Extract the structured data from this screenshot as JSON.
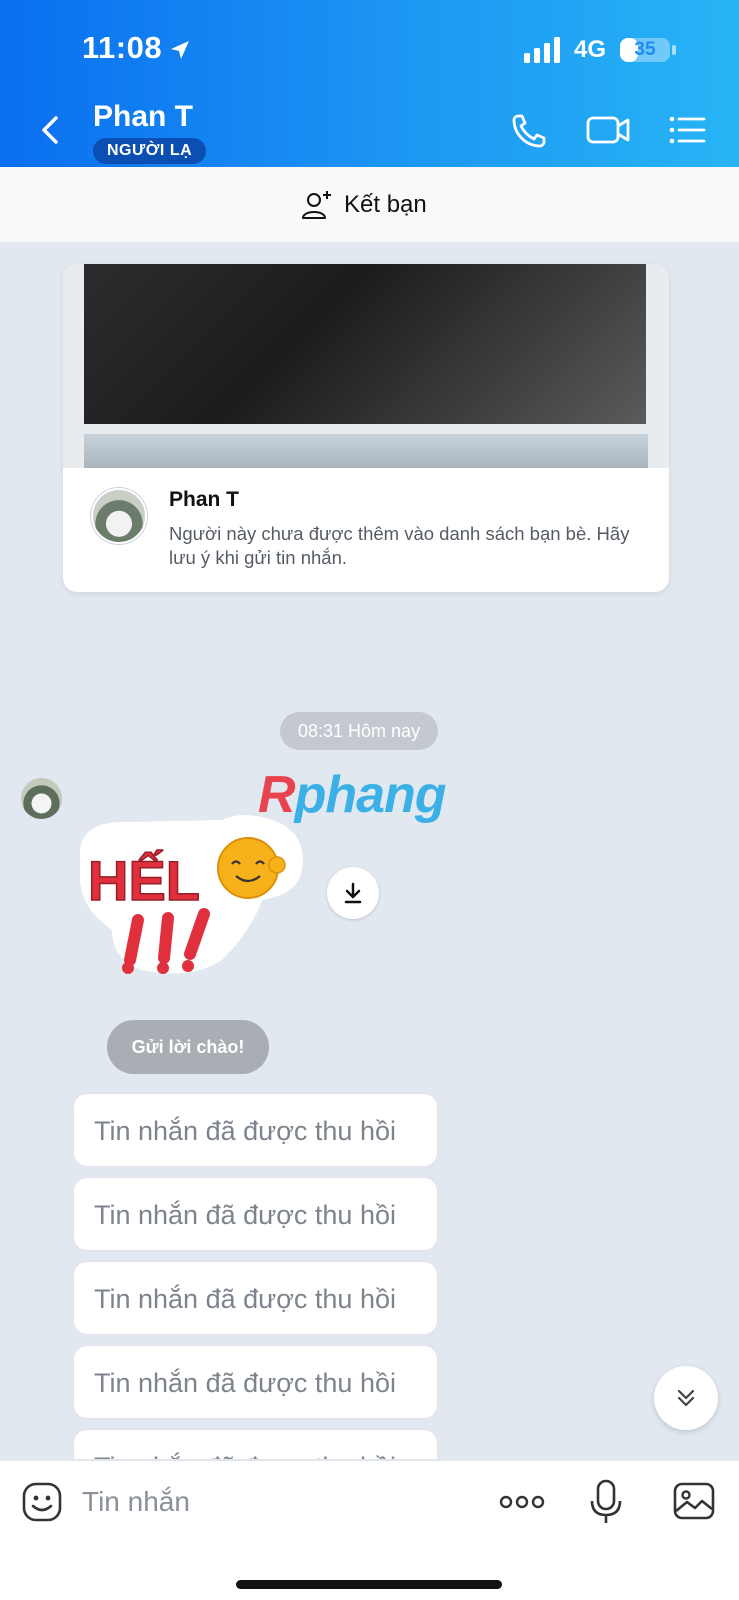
{
  "status_bar": {
    "time": "11:08",
    "network": "4G",
    "battery": "35",
    "battery_level": 0.35
  },
  "header": {
    "contact_name": "Phan T",
    "badge": "NGƯỜI LẠ"
  },
  "add_friend": {
    "label": "Kết bạn"
  },
  "profile_card": {
    "name": "Phan T",
    "note": "Người này chưa được thêm vào danh sách bạn bè. Hãy lưu ý khi gửi tin nhắn."
  },
  "chat": {
    "timestamp": "08:31 Hôm nay",
    "watermark": {
      "first": "R",
      "rest": "phang"
    },
    "sticker_text": "HẾL",
    "greeting_chip": "Gửi lời chào!",
    "recalled_messages": [
      "Tin nhắn đã được thu hồi",
      "Tin nhắn đã được thu hồi",
      "Tin nhắn đã được thu hồi",
      "Tin nhắn đã được thu hồi",
      "Tin nhắn đã được thu hồi"
    ]
  },
  "input_bar": {
    "placeholder": "Tin nhắn"
  },
  "colors": {
    "header_start": "#0a6ff0",
    "header_end": "#27b4f5",
    "badge": "#0b4fb3",
    "chat_bg": "#e2e8f0"
  }
}
